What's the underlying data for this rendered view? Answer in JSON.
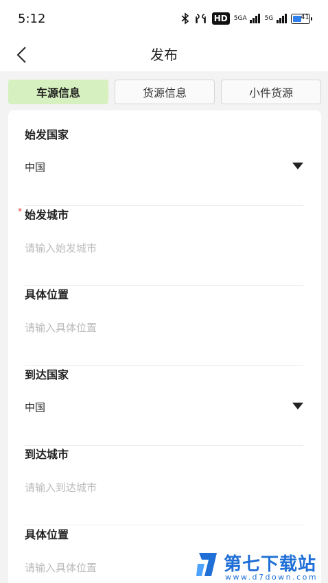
{
  "status_bar": {
    "time": "5:12",
    "icons": [
      "bluetooth-icon",
      "earbuds-icon",
      "hd-icon",
      "signal-5g-icon",
      "signal-5g-icon",
      "battery-icon"
    ],
    "hd_label": "HD",
    "sig1_label": "5GA",
    "sig2_label": "5G",
    "battery_level": "41"
  },
  "nav": {
    "title": "发布",
    "back_icon": "chevron-left-icon"
  },
  "tabs": [
    {
      "label": "车源信息",
      "active": true
    },
    {
      "label": "货源信息",
      "active": false
    },
    {
      "label": "小件货源",
      "active": false
    }
  ],
  "form": {
    "fields": [
      {
        "label": "始发国家",
        "type": "select",
        "value": "中国"
      },
      {
        "label": "始发城市",
        "type": "input",
        "required": true,
        "required_mark": "*",
        "placeholder": "请输入始发城市"
      },
      {
        "label": "具体位置",
        "type": "input",
        "placeholder": "请输入具体位置"
      },
      {
        "label": "到达国家",
        "type": "select",
        "value": "中国"
      },
      {
        "label": "到达城市",
        "type": "input",
        "placeholder": "请输入到达城市"
      },
      {
        "label": "具体位置",
        "type": "input",
        "placeholder": "请输入具体位置"
      }
    ]
  },
  "watermark": {
    "name": "第七下载站",
    "url": "www.d7down.com"
  },
  "colors": {
    "active_tab": "#d7f0bf",
    "required": "#e53935",
    "placeholder": "#bbbbbb",
    "watermark": "#1f6fd6"
  }
}
